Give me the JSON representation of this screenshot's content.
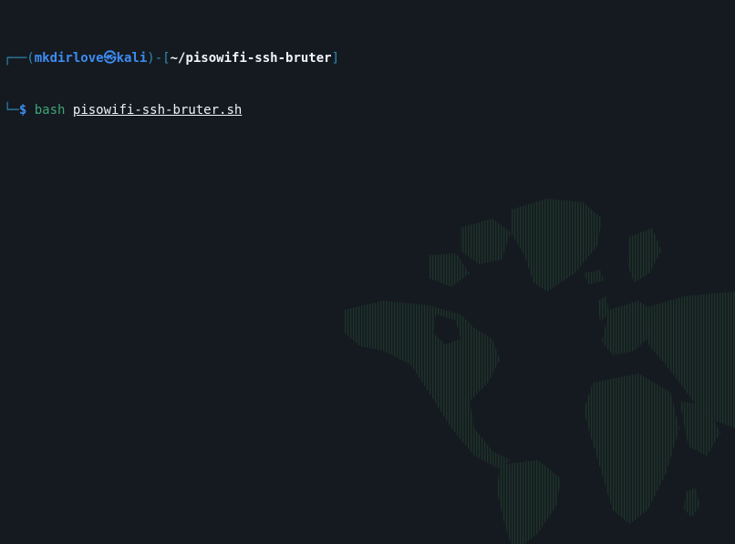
{
  "prompt": {
    "user": "mkdirlove",
    "at_symbol": "㉿",
    "host": "kali",
    "cwd": "~/pisowifi-ssh-bruter",
    "symbol": "$"
  },
  "command": {
    "program": "bash",
    "argument": "pisowifi-ssh-bruter.sh"
  },
  "theme": {
    "background": "#151a21",
    "prompt_color": "#3d8cf0",
    "command_color": "#3fa577",
    "map_dot_color": "#1e3a2b"
  },
  "wallpaper": {
    "icon": "world-map-dots"
  }
}
